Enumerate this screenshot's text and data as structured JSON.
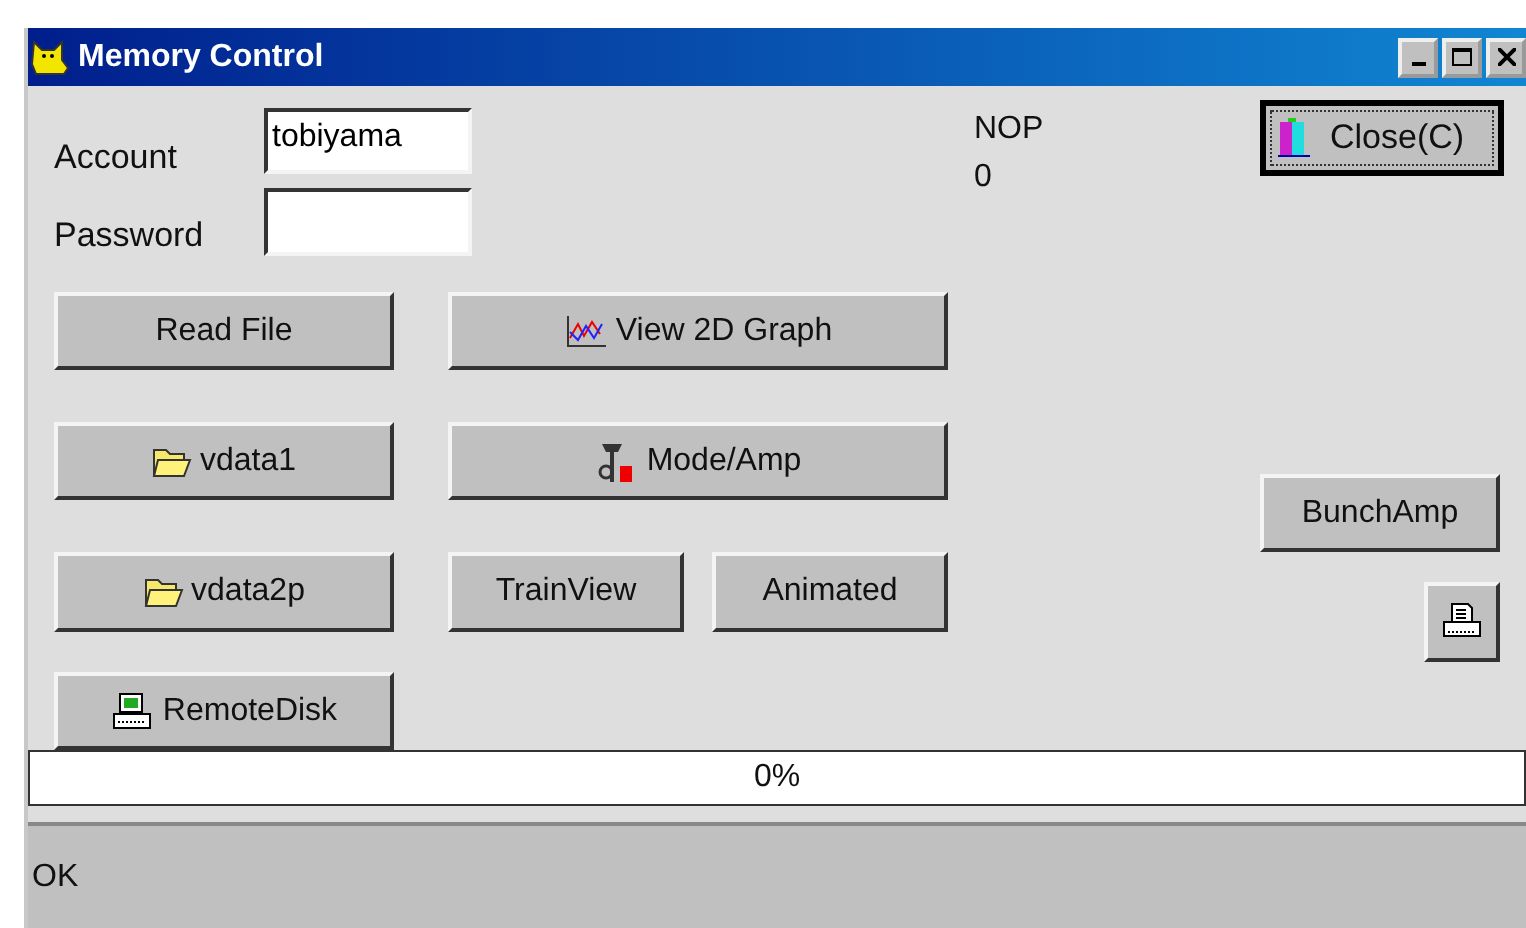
{
  "window": {
    "title": "Memory Control"
  },
  "account": {
    "label": "Account",
    "value": "tobiyama"
  },
  "password": {
    "label": "Password"
  },
  "nop": {
    "label": "NOP",
    "value": "0"
  },
  "close_button": {
    "label": "Close(C)"
  },
  "buttons": {
    "read_file": "Read File",
    "view_graph": "View 2D Graph",
    "vdata1": "vdata1",
    "mode_amp": "Mode/Amp",
    "vdata2p": "vdata2p",
    "train_view": "TrainView",
    "animated": "Animated",
    "remote_disk": "RemoteDisk",
    "bunch_amp": "BunchAmp"
  },
  "progress": {
    "level": 0,
    "reading": "0%"
  },
  "status_bar": {
    "text": "OK"
  }
}
